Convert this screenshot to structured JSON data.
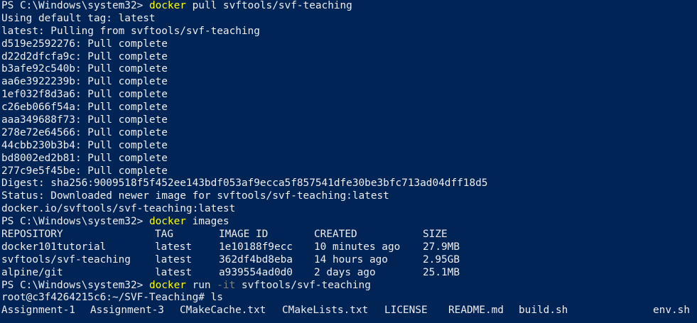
{
  "colors": {
    "background": "#012456",
    "text": "#eeedf0",
    "command": "#ffff00",
    "flag": "#808080"
  },
  "prompt1": {
    "prompt": "PS C:\\Windows\\system32> ",
    "cmd": "docker",
    "args": " pull svftools/svf-teaching"
  },
  "pull_output": [
    "Using default tag: latest",
    "latest: Pulling from svftools/svf-teaching",
    "d519e2592276: Pull complete",
    "d22d2dfcfa9c: Pull complete",
    "b3afe92c540b: Pull complete",
    "aa6e3922239b: Pull complete",
    "1ef032f8d3a6: Pull complete",
    "c26eb066f54a: Pull complete",
    "aaa349688f73: Pull complete",
    "278e72e64566: Pull complete",
    "44cbb230b3b4: Pull complete",
    "bd8002ed2b81: Pull complete",
    "277c9e5f45be: Pull complete",
    "Digest: sha256:9009518f5f452ee143bdf053af9ecca5f857541dfe30be3bfc713ad04dff18d5",
    "Status: Downloaded newer image for svftools/svf-teaching:latest",
    "docker.io/svftools/svf-teaching:latest"
  ],
  "prompt2": {
    "prompt": "PS C:\\Windows\\system32> ",
    "cmd": "docker",
    "args": " images"
  },
  "images_table": {
    "headers": [
      "REPOSITORY",
      "TAG",
      "IMAGE ID",
      "CREATED",
      "SIZE"
    ],
    "rows": [
      [
        "docker101tutorial",
        "latest",
        "1e10188f9ecc",
        "10 minutes ago",
        "27.9MB"
      ],
      [
        "svftools/svf-teaching",
        "latest",
        "362df4bd8eba",
        "14 hours ago",
        "2.95GB"
      ],
      [
        "alpine/git",
        "latest",
        "a939554ad0d0",
        "2 days ago",
        "25.1MB"
      ]
    ]
  },
  "prompt3": {
    "prompt": "PS C:\\Windows\\system32> ",
    "cmd": "docker",
    "args1": " run ",
    "flag": "-it",
    "args2": " svftools/svf-teaching"
  },
  "shell_prompt": "root@c3f4264215c6:~/SVF-Teaching# ls",
  "ls_output": [
    "Assignment-1",
    "Assignment-3",
    "CMakeCache.txt",
    "CMakeLists.txt",
    "LICENSE",
    "README.md",
    "build.sh",
    "env.sh"
  ]
}
